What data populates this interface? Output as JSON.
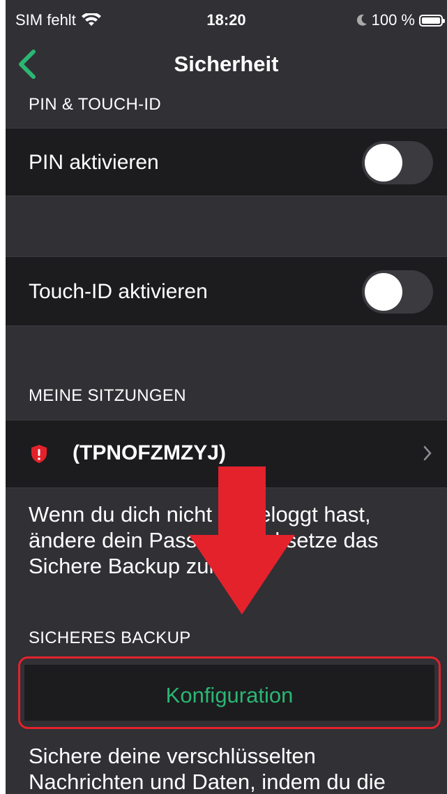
{
  "status_bar": {
    "carrier": "SIM fehlt",
    "time": "18:20",
    "battery": "100 %"
  },
  "nav": {
    "title": "Sicherheit"
  },
  "sections": {
    "pin_header": "PIN & TOUCH-ID",
    "pin_label": "PIN aktivieren",
    "pin_enabled": false,
    "touch_label": "Touch-ID aktivieren",
    "touch_enabled": false,
    "sessions_header": "MEINE SITZUNGEN",
    "session_name": "(TPNOFZMZYJ)",
    "sessions_footer": "Wenn du dich nicht eingeloggt hast, ändere dein Passwort und setze das Sichere Backup zurück.",
    "backup_header": "SICHERES BACKUP",
    "backup_button": "Konfiguration",
    "backup_footer": "Sichere deine verschlüsselten Nachrichten und Daten, indem du die"
  },
  "colors": {
    "accent": "#2bb673",
    "highlight": "#e3222b",
    "background": "#303035",
    "cell": "#1c1c1f"
  }
}
